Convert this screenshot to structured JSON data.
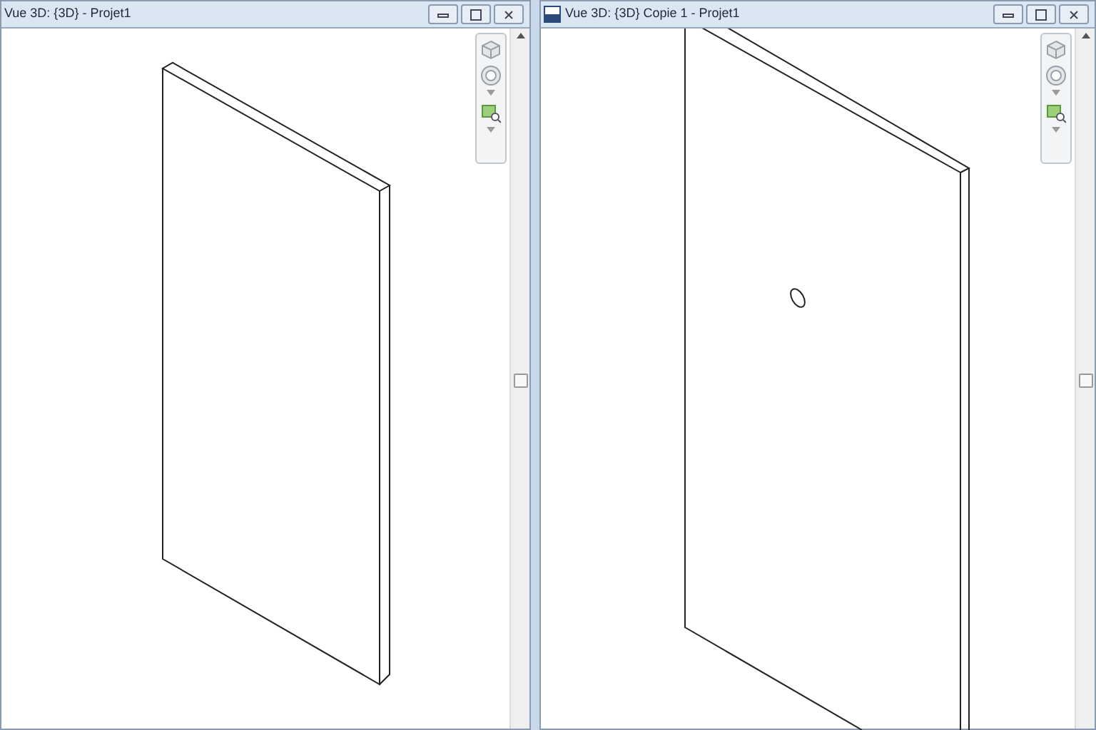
{
  "windows": [
    {
      "title": "Vue 3D: {3D} - Projet1",
      "document_icon": false,
      "kind": "wall"
    },
    {
      "title": "Vue 3D: {3D} Copie 1 - Projet1",
      "document_icon": true,
      "kind": "wall-with-hole"
    }
  ]
}
